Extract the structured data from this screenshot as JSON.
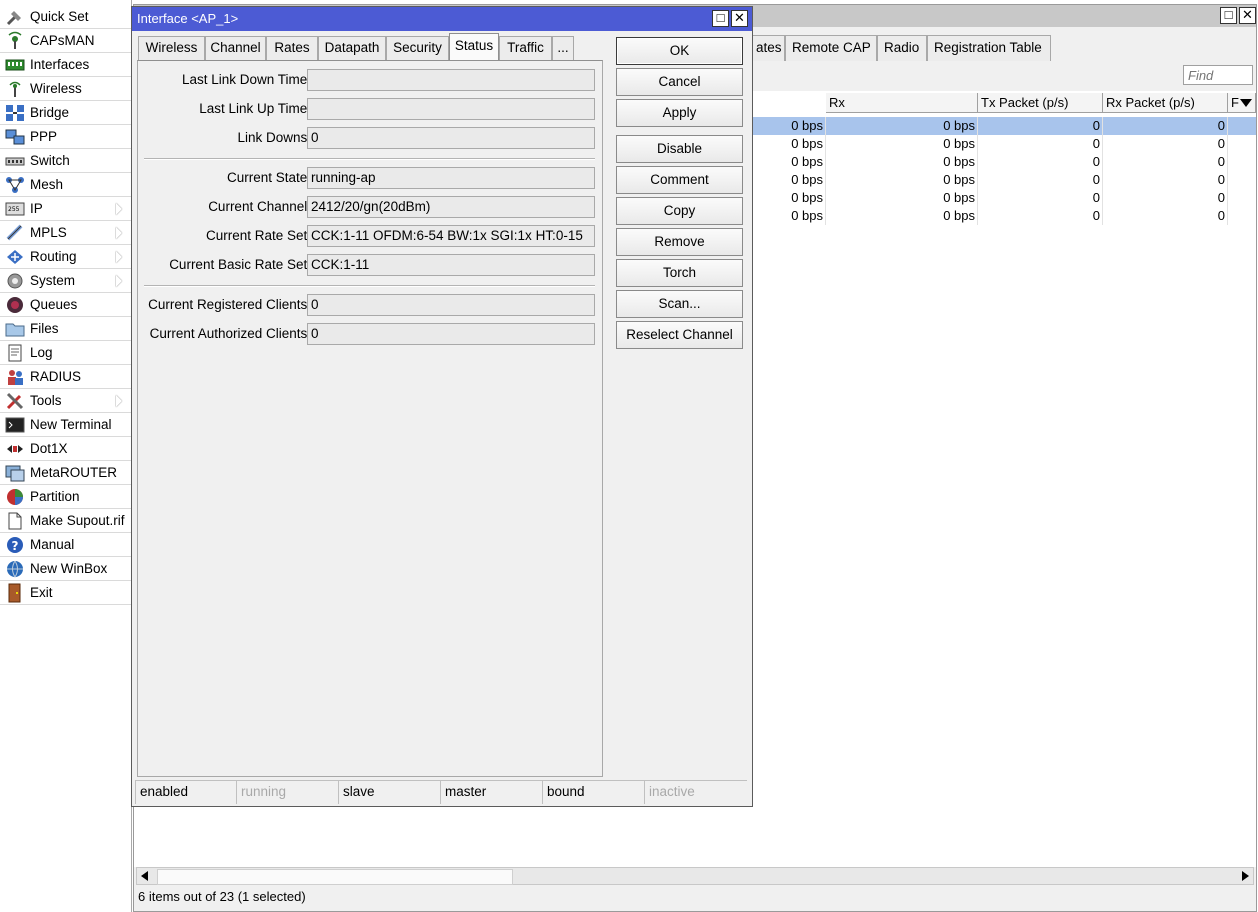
{
  "sidebar": {
    "items": [
      {
        "label": "Quick Set",
        "icon": "quick-set-icon",
        "sub": false
      },
      {
        "label": "CAPsMAN",
        "icon": "capsman-icon",
        "sub": false
      },
      {
        "label": "Interfaces",
        "icon": "interfaces-icon",
        "sub": false
      },
      {
        "label": "Wireless",
        "icon": "wireless-icon",
        "sub": false
      },
      {
        "label": "Bridge",
        "icon": "bridge-icon",
        "sub": false
      },
      {
        "label": "PPP",
        "icon": "ppp-icon",
        "sub": false
      },
      {
        "label": "Switch",
        "icon": "switch-icon",
        "sub": false
      },
      {
        "label": "Mesh",
        "icon": "mesh-icon",
        "sub": false
      },
      {
        "label": "IP",
        "icon": "ip-icon",
        "sub": true
      },
      {
        "label": "MPLS",
        "icon": "mpls-icon",
        "sub": true
      },
      {
        "label": "Routing",
        "icon": "routing-icon",
        "sub": true
      },
      {
        "label": "System",
        "icon": "system-gear-icon",
        "sub": true
      },
      {
        "label": "Queues",
        "icon": "queues-icon",
        "sub": false
      },
      {
        "label": "Files",
        "icon": "files-folder-icon",
        "sub": false
      },
      {
        "label": "Log",
        "icon": "log-icon",
        "sub": false
      },
      {
        "label": "RADIUS",
        "icon": "radius-users-icon",
        "sub": false
      },
      {
        "label": "Tools",
        "icon": "tools-icon",
        "sub": true
      },
      {
        "label": "New Terminal",
        "icon": "terminal-icon",
        "sub": false
      },
      {
        "label": "Dot1X",
        "icon": "dot1x-icon",
        "sub": false
      },
      {
        "label": "MetaROUTER",
        "icon": "metarouter-icon",
        "sub": false
      },
      {
        "label": "Partition",
        "icon": "partition-pie-icon",
        "sub": false
      },
      {
        "label": "Make Supout.rif",
        "icon": "supout-file-icon",
        "sub": false
      },
      {
        "label": "Manual",
        "icon": "manual-help-icon",
        "sub": false
      },
      {
        "label": "New WinBox",
        "icon": "winbox-globe-icon",
        "sub": false
      },
      {
        "label": "Exit",
        "icon": "exit-door-icon",
        "sub": false
      }
    ]
  },
  "bgwindow": {
    "tabs": [
      "ates",
      "Remote CAP",
      "Radio",
      "Registration Table"
    ],
    "find_placeholder": "Find",
    "columns": [
      "Rx",
      "Tx Packet (p/s)",
      "Rx Packet (p/s)",
      "F"
    ],
    "rows": [
      {
        "tx": "0 bps",
        "rx": "0 bps",
        "txp": "0",
        "rxp": "0",
        "selected": true
      },
      {
        "tx": "0 bps",
        "rx": "0 bps",
        "txp": "0",
        "rxp": "0",
        "selected": false
      },
      {
        "tx": "0 bps",
        "rx": "0 bps",
        "txp": "0",
        "rxp": "0",
        "selected": false
      },
      {
        "tx": "0 bps",
        "rx": "0 bps",
        "txp": "0",
        "rxp": "0",
        "selected": false
      },
      {
        "tx": "0 bps",
        "rx": "0 bps",
        "txp": "0",
        "rxp": "0",
        "selected": false
      },
      {
        "tx": "0 bps",
        "rx": "0 bps",
        "txp": "0",
        "rxp": "0",
        "selected": false
      }
    ],
    "status": "6 items out of 23 (1 selected)"
  },
  "dialog": {
    "title": "Interface <AP_1>",
    "tabs": [
      "Wireless",
      "Channel",
      "Rates",
      "Datapath",
      "Security",
      "Status",
      "Traffic",
      "..."
    ],
    "active_tab": "Status",
    "fields": {
      "last_link_down": {
        "label": "Last Link Down Time:",
        "value": ""
      },
      "last_link_up": {
        "label": "Last Link Up Time:",
        "value": ""
      },
      "link_downs": {
        "label": "Link Downs:",
        "value": "0"
      },
      "current_state": {
        "label": "Current State:",
        "value": "running-ap"
      },
      "current_channel": {
        "label": "Current Channel:",
        "value": "2412/20/gn(20dBm)"
      },
      "current_rate_set": {
        "label": "Current Rate Set:",
        "value": "CCK:1-11 OFDM:6-54 BW:1x SGI:1x HT:0-15"
      },
      "current_basic_rate_set": {
        "label": "Current Basic Rate Set:",
        "value": "CCK:1-11"
      },
      "registered_clients": {
        "label": "Current Registered Clients:",
        "value": "0"
      },
      "authorized_clients": {
        "label": "Current Authorized Clients:",
        "value": "0"
      }
    },
    "buttons": [
      "OK",
      "Cancel",
      "Apply",
      "Disable",
      "Comment",
      "Copy",
      "Remove",
      "Torch",
      "Scan...",
      "Reselect Channel"
    ],
    "statusbar": [
      {
        "label": "enabled",
        "dim": false
      },
      {
        "label": "running",
        "dim": true
      },
      {
        "label": "slave",
        "dim": false
      },
      {
        "label": "master",
        "dim": false
      },
      {
        "label": "bound",
        "dim": false
      },
      {
        "label": "inactive",
        "dim": true
      }
    ]
  },
  "colors": {
    "dialog_title_bg": "#4c5bd4",
    "selected_row": "#a8c4ec",
    "window_bg": "#f0f0f0"
  }
}
